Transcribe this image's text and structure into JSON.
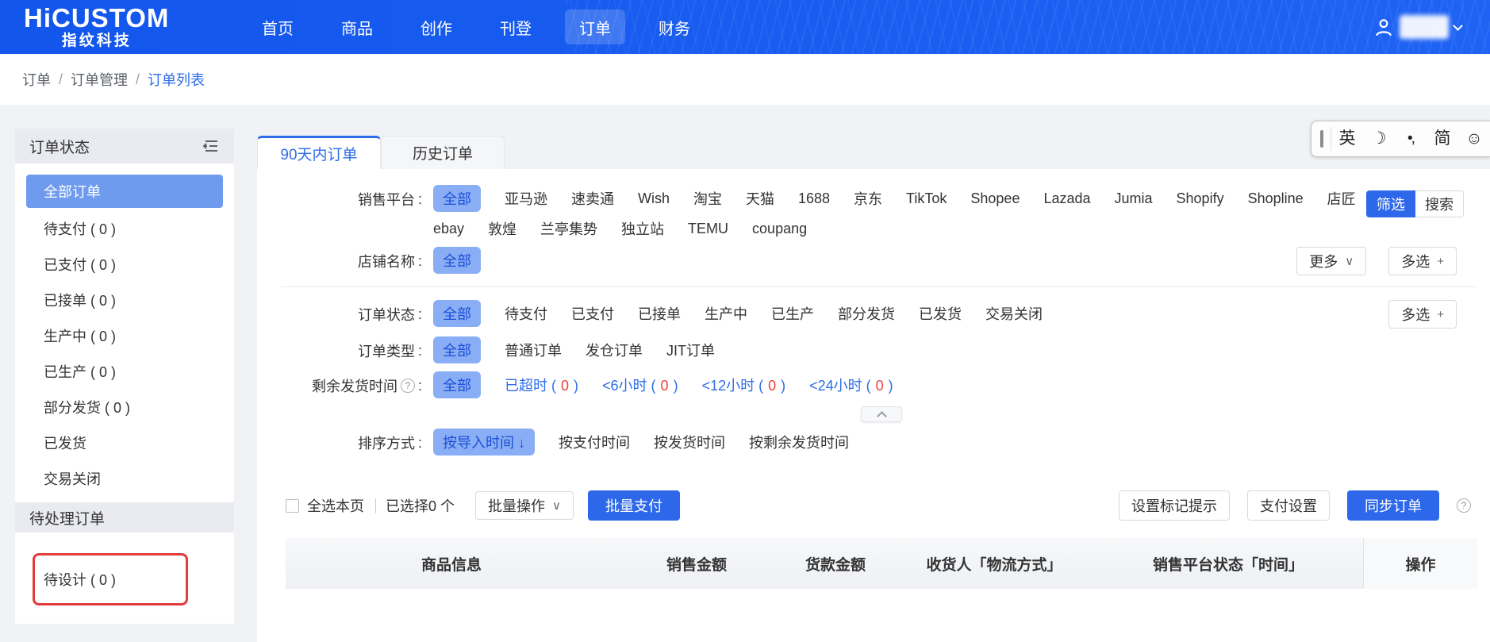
{
  "nav": {
    "logo_title": "HiCUSTOM",
    "logo_subtitle": "指纹科技",
    "items": [
      {
        "label": "首页"
      },
      {
        "label": "商品"
      },
      {
        "label": "创作"
      },
      {
        "label": "刊登"
      },
      {
        "label": "订单",
        "active": true
      },
      {
        "label": "财务"
      }
    ]
  },
  "breadcrumb": {
    "separator": "/",
    "items": [
      "订单",
      "订单管理",
      "订单列表"
    ]
  },
  "ime": {
    "en": "英",
    "moon": "☽",
    "punct": "•,",
    "simplified": "简",
    "smiley": "☺"
  },
  "sidebar": {
    "title": "订单状态",
    "items": [
      {
        "label": "全部订单",
        "selected": true
      },
      {
        "label": "待支付 ( 0 )"
      },
      {
        "label": "已支付 ( 0 )"
      },
      {
        "label": "已接单 ( 0 )"
      },
      {
        "label": "生产中 ( 0 )"
      },
      {
        "label": "已生产 ( 0 )"
      },
      {
        "label": "部分发货 ( 0 )"
      },
      {
        "label": "已发货"
      },
      {
        "label": "交易关闭"
      }
    ],
    "pending_title": "待处理订单",
    "pending_items": [
      {
        "label": "待设计 ( 0 )",
        "annotated": true
      }
    ]
  },
  "tabs": [
    {
      "label": "90天内订单",
      "active": true
    },
    {
      "label": "历史订单"
    }
  ],
  "filters": {
    "platform": {
      "label": "销售平台",
      "selected": "全部",
      "row1": [
        "亚马逊",
        "速卖通",
        "Wish",
        "淘宝",
        "天猫",
        "1688",
        "京东",
        "TikTok",
        "Shopee",
        "Lazada",
        "Jumia",
        "Shopify",
        "Shopline",
        "店匠"
      ],
      "row2": [
        "ebay",
        "敦煌",
        "兰亭集势",
        "独立站",
        "TEMU",
        "coupang"
      ]
    },
    "store": {
      "label": "店铺名称",
      "selected": "全部"
    },
    "order_status": {
      "label": "订单状态",
      "selected": "全部",
      "options": [
        "待支付",
        "已支付",
        "已接单",
        "生产中",
        "已生产",
        "部分发货",
        "已发货",
        "交易关闭"
      ]
    },
    "order_type": {
      "label": "订单类型",
      "selected": "全部",
      "options": [
        "普通订单",
        "发仓订单",
        "JIT订单"
      ]
    },
    "remaining_time": {
      "label": "剩余发货时间",
      "selected": "全部",
      "options": [
        {
          "pre": "已超时 ( ",
          "num": "0",
          "post": " )"
        },
        {
          "pre": "<6小时 ( ",
          "num": "0",
          "post": " )"
        },
        {
          "pre": "<12小时 ( ",
          "num": "0",
          "post": " )"
        },
        {
          "pre": "<24小时 ( ",
          "num": "0",
          "post": " )"
        }
      ]
    },
    "sort": {
      "label": "排序方式",
      "selected": "按导入时间 ↓",
      "options": [
        "按支付时间",
        "按发货时间",
        "按剩余发货时间"
      ]
    },
    "buttons": {
      "filter": "筛选",
      "search": "搜索",
      "more": "更多",
      "multi": "多选"
    }
  },
  "action_bar": {
    "select_all": "全选本页",
    "selected_info": "已选择0 个",
    "batch_ops": "批量操作",
    "batch_pay": "批量支付",
    "set_mark": "设置标记提示",
    "pay_settings": "支付设置",
    "sync_orders": "同步订单"
  },
  "table": {
    "columns": [
      "商品信息",
      "销售金额",
      "货款金额",
      "收货人「物流方式」",
      "销售平台状态「时间」",
      "操作"
    ]
  },
  "ui": {
    "colon": ":",
    "caret_down": "∨",
    "plus": "+",
    "help": "?"
  },
  "colors": {
    "nav_blue": "#1256ec",
    "accent_blue": "#2e6ce8",
    "chip_bg": "#8aaef5",
    "chip_text": "#1b4fd6",
    "sidebar_selected_bg": "#6f9bef",
    "count_red": "#f0413c",
    "annotation_red": "#e23c3c",
    "page_bg": "#f0f2f5",
    "section_bg": "#e9ebf1"
  }
}
